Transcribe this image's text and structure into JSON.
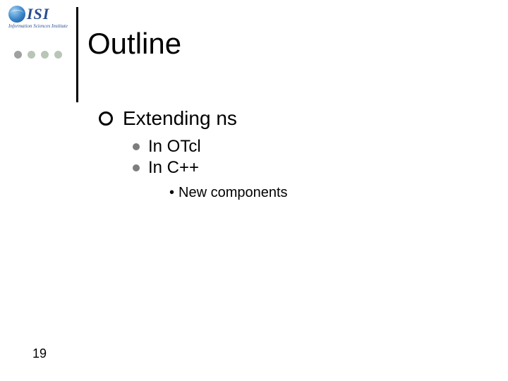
{
  "logo": {
    "letters": "ISI",
    "subtitle": "Information Sciences Institute"
  },
  "deco_dot_colors": [
    "#9fa0a0",
    "#b9c6b7",
    "#b9c6b7",
    "#b9c6b7"
  ],
  "title": "Outline",
  "outline": {
    "level1": "Extending ns",
    "level2": [
      "In OTcl",
      "In C++"
    ],
    "level3": [
      "New components"
    ]
  },
  "page_number": "19"
}
